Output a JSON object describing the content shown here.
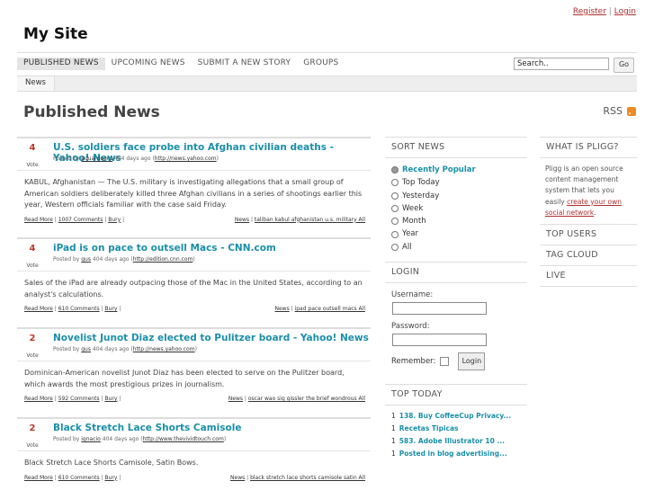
{
  "header": {
    "register": "Register",
    "sep": "|",
    "login": "Login",
    "site_title": "My Site"
  },
  "nav": {
    "items": [
      "PUBLISHED NEWS",
      "UPCOMING NEWS",
      "SUBMIT A NEW STORY",
      "GROUPS"
    ],
    "search_value": "Search..",
    "go": "Go"
  },
  "subnav": {
    "category": "News"
  },
  "page": {
    "title": "Published News",
    "rss": "RSS"
  },
  "stories": [
    {
      "votes": "4",
      "vote_label": "Vote",
      "title": "U.S. soldiers face probe into Afghan civilian deaths - Yahoo! News",
      "meta_prefix": "Posted by",
      "user": "eduardoeru",
      "meta_time": "404 days ago (",
      "source": "http://news.yahoo.com",
      "meta_suffix": ")",
      "body": "KABUL, Afghanistan — The U.S. military is investigating allegations that a small group of American soldiers deliberately killed three Afghan civilians in a series of shootings earlier this year, Western officials familiar with the case said Friday.",
      "read_more": "Read More",
      "comments": "1007 Comments",
      "bury": "Bury",
      "category": "News",
      "tags": "taliban kabul afghanistan u.s. military All"
    },
    {
      "votes": "4",
      "vote_label": "Vote",
      "title": "iPad is on pace to outsell Macs - CNN.com",
      "meta_prefix": "Posted by",
      "user": "gus",
      "meta_time": "404 days ago (",
      "source": "http://edition.cnn.com",
      "meta_suffix": ")",
      "body": "Sales of the iPad are already outpacing those of the Mac in the United States, according to an analyst's calculations.",
      "read_more": "Read More",
      "comments": "610 Comments",
      "bury": "Bury",
      "category": "News",
      "tags": "ipad pace outsell macs All"
    },
    {
      "votes": "2",
      "vote_label": "Vote",
      "title": "Novelist Junot Diaz elected to Pulitzer board - Yahoo! News",
      "meta_prefix": "Posted by",
      "user": "gus",
      "meta_time": "404 days ago (",
      "source": "http://news.yahoo.com",
      "meta_suffix": ")",
      "body": "Dominican-American novelist Junot Diaz has been elected to serve on the Pulitzer board, which awards the most prestigious prizes in journalism.",
      "read_more": "Read More",
      "comments": "592 Comments",
      "bury": "Bury",
      "category": "News",
      "tags": "oscar wao sig gissler the brief wondrous All"
    },
    {
      "votes": "2",
      "vote_label": "Vote",
      "title": "Black Stretch Lace Shorts Camisole",
      "meta_prefix": "Posted by",
      "user": "ignacio",
      "meta_time": "404 days ago (",
      "source": "http://www.thevividtouch.com",
      "meta_suffix": ")",
      "body": "Black Stretch Lace Shorts Camisole, Satin Bows.",
      "read_more": "Read More",
      "comments": "610 Comments",
      "bury": "Bury",
      "category": "News",
      "tags": "black stretch lace shorts camisole satin All"
    }
  ],
  "sort": {
    "heading": "SORT NEWS",
    "options": [
      "Recently Popular",
      "Top Today",
      "Yesterday",
      "Week",
      "Month",
      "Year",
      "All"
    ]
  },
  "login_box": {
    "heading": "LOGIN",
    "username": "Username:",
    "password": "Password:",
    "remember": "Remember:",
    "button": "Login"
  },
  "top_today": {
    "heading": "TOP TODAY",
    "items": [
      {
        "n": "1",
        "t": "138. Buy CoffeeCup Privacy..."
      },
      {
        "n": "1",
        "t": "Recetas Tipicas"
      },
      {
        "n": "1",
        "t": "583. Adobe Illustrator 10 ..."
      },
      {
        "n": "1",
        "t": "Posted in blog advertising..."
      }
    ]
  },
  "right": {
    "about_heading": "WHAT IS PLIGG?",
    "about_text": "Pligg is an open source content management system that lets you easily ",
    "about_link": "create your own social network",
    "about_end": ".",
    "top_users": "TOP USERS",
    "tag_cloud": "TAG CLOUD",
    "live": "LIVE"
  },
  "colors": {
    "accent": "#1a8fa8",
    "vote": "#c0392b",
    "header_link": "#b03030",
    "rss": "#f08a24"
  }
}
